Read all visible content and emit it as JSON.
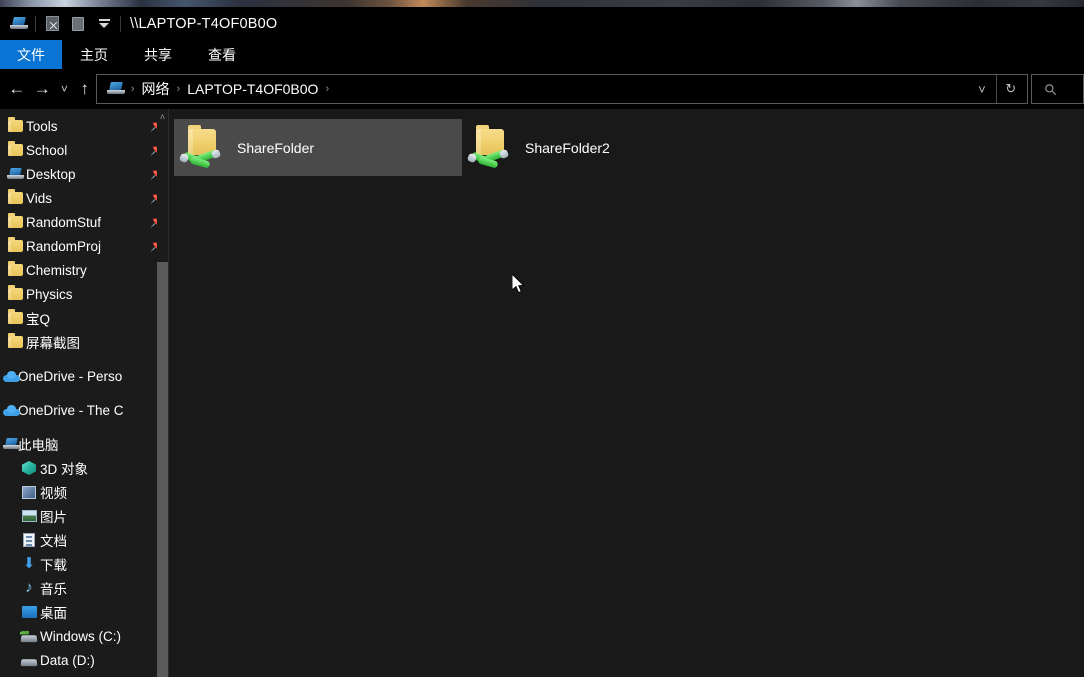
{
  "window": {
    "title": "\\\\LAPTOP-T4OF0B0O",
    "quick_access_icons": [
      "network-computer-icon",
      "properties-icon",
      "new-folder-icon",
      "customize-quick-access-caret-icon"
    ]
  },
  "ribbon": {
    "tabs": [
      {
        "label": "文件",
        "name": "tab-file",
        "active": true
      },
      {
        "label": "主页",
        "name": "tab-home",
        "active": false
      },
      {
        "label": "共享",
        "name": "tab-share",
        "active": false
      },
      {
        "label": "查看",
        "name": "tab-view",
        "active": false
      }
    ]
  },
  "navigation": {
    "back": "←",
    "forward": "→",
    "recent": "˅",
    "up": "↑",
    "breadcrumb": {
      "icon": "network-computer-icon",
      "items": [
        "网络",
        "LAPTOP-T4OF0B0O"
      ],
      "separator": "›"
    },
    "dropdown": "˅",
    "refresh": "↻",
    "search_placeholder": ""
  },
  "sidebar": {
    "scroll_up_arrow": "˄",
    "items": [
      {
        "label": "Tools",
        "icon": "folder-icon",
        "pinned": true,
        "indent": 1
      },
      {
        "label": "School",
        "icon": "folder-icon",
        "pinned": true,
        "indent": 1
      },
      {
        "label": "Desktop",
        "icon": "computer-icon",
        "pinned": true,
        "indent": 1
      },
      {
        "label": "Vids",
        "icon": "folder-icon",
        "pinned": true,
        "indent": 1
      },
      {
        "label": "RandomStuf",
        "icon": "folder-icon",
        "pinned": true,
        "indent": 1
      },
      {
        "label": "RandomProj",
        "icon": "folder-icon",
        "pinned": true,
        "indent": 1
      },
      {
        "label": "Chemistry",
        "icon": "folder-icon",
        "pinned": false,
        "indent": 1
      },
      {
        "label": "Physics",
        "icon": "folder-icon",
        "pinned": false,
        "indent": 1
      },
      {
        "label": "宝Q",
        "icon": "folder-icon",
        "pinned": false,
        "indent": 1
      },
      {
        "label": "屏幕截图",
        "icon": "folder-icon",
        "pinned": false,
        "indent": 1
      },
      {
        "label": "OneDrive - Perso",
        "icon": "onedrive-cloud-icon",
        "pinned": false,
        "indent": 0,
        "gap_before": true
      },
      {
        "label": "OneDrive - The C",
        "icon": "onedrive-cloud-icon",
        "pinned": false,
        "indent": 0,
        "gap_before": true
      },
      {
        "label": "此电脑",
        "icon": "this-pc-icon",
        "pinned": false,
        "indent": 0,
        "gap_before": true
      },
      {
        "label": "3D 对象",
        "icon": "3d-objects-icon",
        "pinned": false,
        "indent": 2
      },
      {
        "label": "视频",
        "icon": "videos-icon",
        "pinned": false,
        "indent": 2
      },
      {
        "label": "图片",
        "icon": "pictures-icon",
        "pinned": false,
        "indent": 2
      },
      {
        "label": "文档",
        "icon": "documents-icon",
        "pinned": false,
        "indent": 2
      },
      {
        "label": "下载",
        "icon": "downloads-icon",
        "pinned": false,
        "indent": 2
      },
      {
        "label": "音乐",
        "icon": "music-icon",
        "pinned": false,
        "indent": 2
      },
      {
        "label": "桌面",
        "icon": "desktop-icon",
        "pinned": false,
        "indent": 2
      },
      {
        "label": "Windows (C:)",
        "icon": "windows-drive-icon",
        "pinned": false,
        "indent": 2
      },
      {
        "label": "Data (D:)",
        "icon": "drive-icon",
        "pinned": false,
        "indent": 2
      }
    ]
  },
  "content": {
    "items": [
      {
        "label": "ShareFolder",
        "icon": "shared-folder-icon",
        "selected": true
      },
      {
        "label": "ShareFolder2",
        "icon": "shared-folder-icon",
        "selected": false
      }
    ]
  },
  "colors": {
    "accent": "#0a74d4",
    "window_bg": "#000000",
    "pane_bg": "#1b1b1b",
    "content_bg": "#191919",
    "selection": "#4a4a4a",
    "folder_yellow": "#f0cf6c",
    "share_green": "#2fb132",
    "text": "#ffffff"
  }
}
